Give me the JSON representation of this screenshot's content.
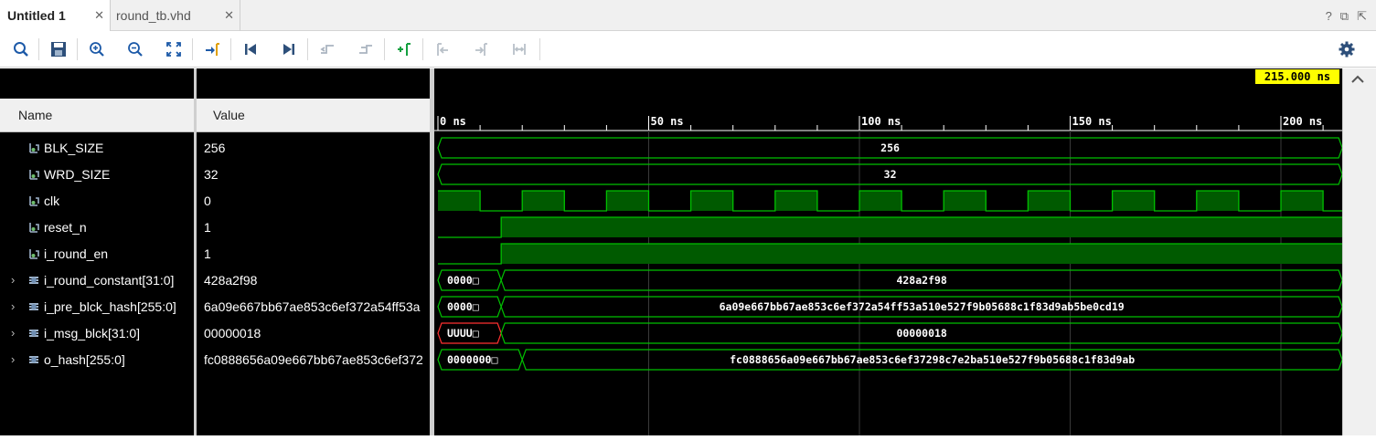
{
  "tabs": [
    {
      "label": "Untitled 1"
    },
    {
      "label": "round_tb.vhd"
    }
  ],
  "window_controls": [
    "?",
    "⧉",
    "⇱"
  ],
  "columns": {
    "name": "Name",
    "value": "Value"
  },
  "signals": [
    {
      "name": "BLK_SIZE",
      "value": "256",
      "kind": "scalar"
    },
    {
      "name": "WRD_SIZE",
      "value": "32",
      "kind": "scalar"
    },
    {
      "name": "clk",
      "value": "0",
      "kind": "scalar"
    },
    {
      "name": "reset_n",
      "value": "1",
      "kind": "scalar"
    },
    {
      "name": "i_round_en",
      "value": "1",
      "kind": "scalar"
    },
    {
      "name": "i_round_constant[31:0]",
      "value": "428a2f98",
      "kind": "bus"
    },
    {
      "name": "i_pre_blck_hash[255:0]",
      "value": "6a09e667bb67ae853c6ef372a54ff53a",
      "kind": "bus"
    },
    {
      "name": "i_msg_blck[31:0]",
      "value": "00000018",
      "kind": "bus"
    },
    {
      "name": "o_hash[255:0]",
      "value": "fc0888656a09e667bb67ae853c6ef372",
      "kind": "bus"
    }
  ],
  "wave": {
    "cursor_label": "215.000 ns",
    "time_labels": [
      "0 ns",
      "50 ns",
      "100 ns",
      "150 ns",
      "200 ns"
    ],
    "bus_texts": {
      "blk_size": "256",
      "wrd_size": "32",
      "round_constant_initial": "0000□",
      "round_constant": "428a2f98",
      "pre_blck_hash_initial": "0000□",
      "pre_blck_hash": "6a09e667bb67ae853c6ef372a54ff53a510e527f9b05688c1f83d9ab5be0cd19",
      "msg_blck_initial": "UUUU□",
      "msg_blck": "00000018",
      "o_hash_initial": "0000000□",
      "o_hash": "fc0888656a09e667bb67ae853c6ef37298c7e2ba510e527f9b05688c1f83d9ab"
    }
  },
  "colors": {
    "wave_green": "#00c000",
    "wave_fill": "#005a00",
    "cursor_yellow": "#ffff00",
    "undefined_red": "#ff3030"
  }
}
